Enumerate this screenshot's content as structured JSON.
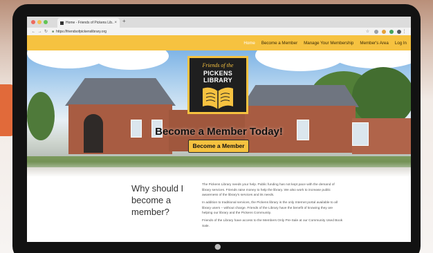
{
  "browser": {
    "tab_title": "Home - Friends of Pickens Lib...",
    "tab_close": "×",
    "new_tab": "+",
    "url": "https://friendsofpickenslibrary.org"
  },
  "site_nav": {
    "items": [
      {
        "label": "Home",
        "active": true
      },
      {
        "label": "Become a Member",
        "active": false
      },
      {
        "label": "Manage Your Membership",
        "active": false
      },
      {
        "label": "Member's Area",
        "active": false
      },
      {
        "label": "Log In",
        "active": false
      }
    ]
  },
  "hero": {
    "logo_line1": "Friends of the",
    "logo_line2": "PICKENS LIBRARY",
    "headline": "Become a Member Today!",
    "button_label": "Become a Member"
  },
  "content": {
    "heading": "Why should I become a member?",
    "paragraphs": [
      "The Pickens Library needs your help. Public funding has not kept pace with the demand of library services. Friends raise money to help the library. We also work to increase public awareness of the library's services and its needs.",
      "In addition to traditional services, the Pickens library is the only Internet portal available to all library users – without charge. Friends of the Library have the benefit of knowing they are helping our library and the Pickens Community.",
      "Friends of the Library have access to the Members Only Pre-Sale at our Community Used Book Sale."
    ]
  },
  "colors": {
    "accent": "#f6c240",
    "header_text": "#3a2b06",
    "logo_bg": "#1f1f1f"
  },
  "icons": {
    "back": "back-arrow-icon",
    "forward": "forward-arrow-icon",
    "reload": "reload-icon",
    "lock": "lock-icon",
    "star": "bookmark-star-icon",
    "apple": "apple-logo-icon"
  }
}
